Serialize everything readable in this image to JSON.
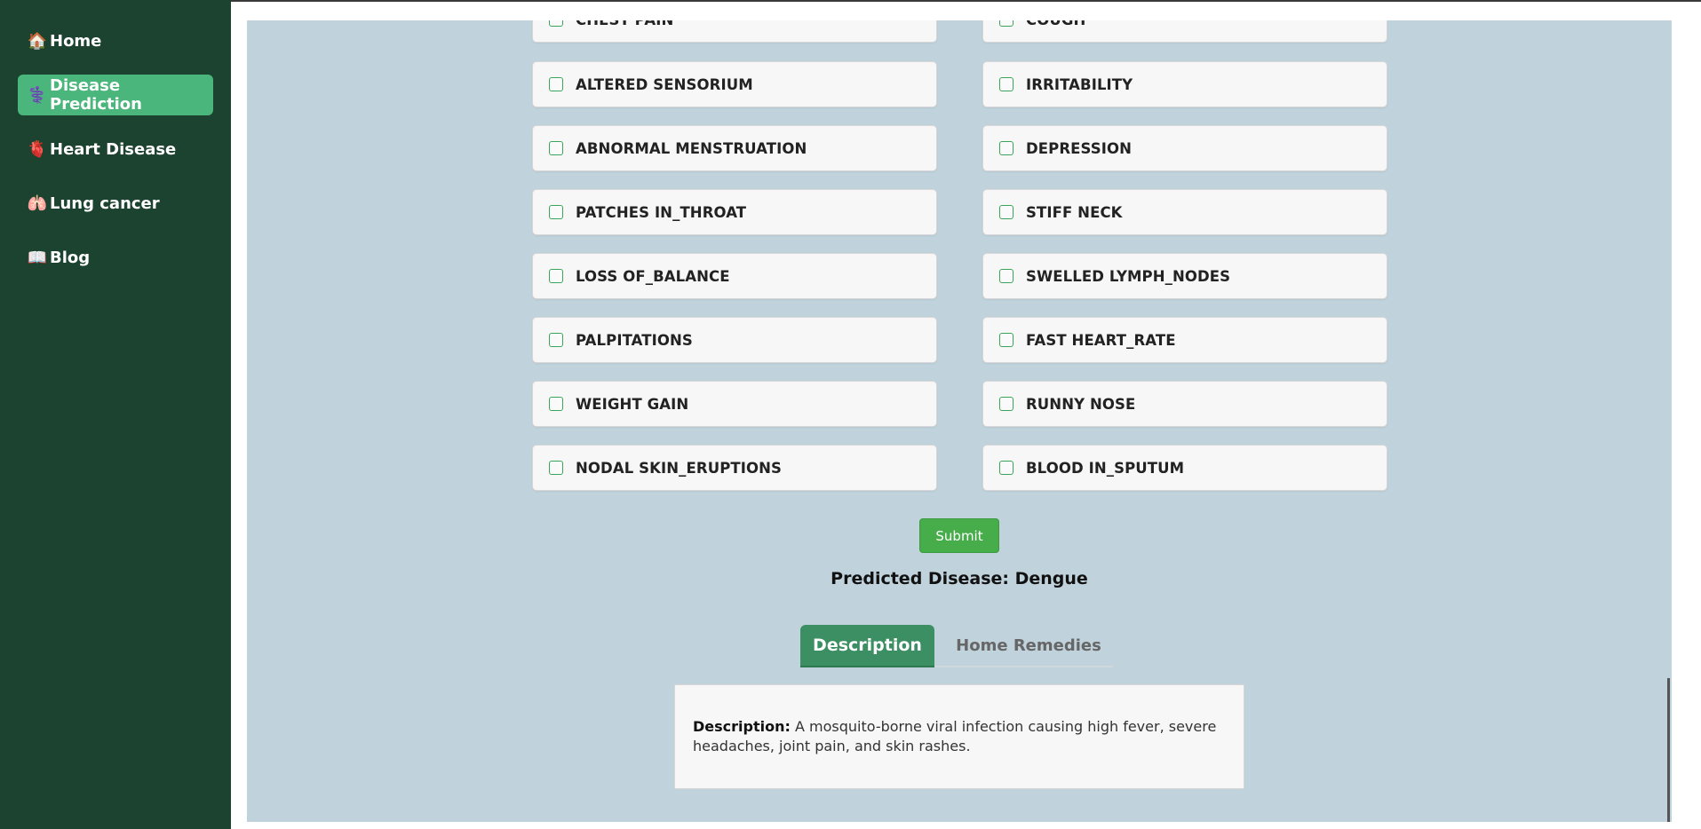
{
  "sidebar": {
    "items": [
      {
        "icon": "house-icon",
        "icon_glyph": "🏠",
        "label": "Home",
        "active": false
      },
      {
        "icon": "medical-icon",
        "icon_glyph": "⚕️",
        "label": "Disease Prediction",
        "active": true
      },
      {
        "icon": "heart-icon",
        "icon_glyph": "🫀",
        "label": "Heart Disease",
        "active": false
      },
      {
        "icon": "lungs-icon",
        "icon_glyph": "🫁",
        "label": "Lung cancer",
        "active": false
      },
      {
        "icon": "book-icon",
        "icon_glyph": "📖",
        "label": "Blog",
        "active": false
      }
    ]
  },
  "symptoms": {
    "left": [
      "CHEST PAIN",
      "ALTERED SENSORIUM",
      "ABNORMAL MENSTRUATION",
      "PATCHES IN_THROAT",
      "LOSS OF_BALANCE",
      "PALPITATIONS",
      "WEIGHT GAIN",
      "NODAL SKIN_ERUPTIONS"
    ],
    "right": [
      "COUGH",
      "IRRITABILITY",
      "DEPRESSION",
      "STIFF NECK",
      "SWELLED LYMPH_NODES",
      "FAST HEART_RATE",
      "RUNNY NOSE",
      "BLOOD IN_SPUTUM"
    ]
  },
  "form": {
    "submit_label": "Submit",
    "predicted_text": "Predicted Disease: Dengue"
  },
  "tabs": {
    "description_label": "Description",
    "remedies_label": "Home Remedies",
    "active": "Description"
  },
  "description": {
    "heading": "Description:",
    "text": " A mosquito-borne viral infection causing high fever, severe headaches, joint pain, and skin rashes."
  },
  "colors": {
    "sidebar_bg": "#1c4330",
    "sidebar_active": "#4bb67b",
    "main_bg": "#c0d3dc",
    "submit_bg": "#46ad4a",
    "tab_active_bg": "#3c8f63"
  }
}
